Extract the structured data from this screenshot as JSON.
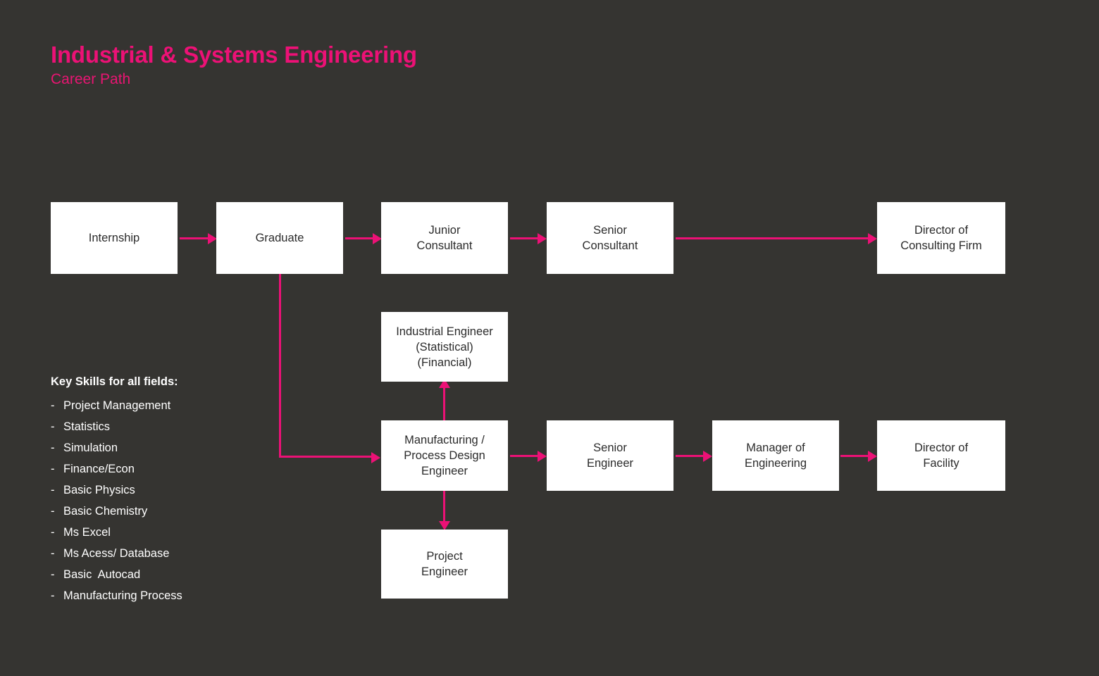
{
  "header": {
    "title": "Industrial & Systems Engineering",
    "subtitle": "Career Path"
  },
  "colors": {
    "background": "#353431",
    "accent": "#ec1176",
    "node_fill": "#ffffff",
    "node_text": "#2b2b2b",
    "skill_text": "#ffffff"
  },
  "nodes": {
    "internship": "Internship",
    "graduate": "Graduate",
    "junior_consultant": "Junior\nConsultant",
    "senior_consultant": "Senior\nConsultant",
    "director_consulting_firm": "Director of\nConsulting Firm",
    "industrial_engineer": "Industrial Engineer\n(Statistical)\n(Financial)",
    "manufacturing_process_design_engineer": "Manufacturing /\nProcess Design\nEngineer",
    "project_engineer": "Project\nEngineer",
    "senior_engineer": "Senior\nEngineer",
    "manager_of_engineering": "Manager of\nEngineering",
    "director_of_facility": "Director of\nFacility"
  },
  "skills": {
    "heading": "Key Skills for all fields:",
    "bullet": "-",
    "items": [
      "Project Management",
      "Statistics",
      "Simulation",
      "Finance/Econ",
      "Basic Physics",
      "Basic Chemistry",
      "Ms Excel",
      "Ms Acess/ Database",
      "Basic  Autocad",
      "Manufacturing Process"
    ]
  }
}
